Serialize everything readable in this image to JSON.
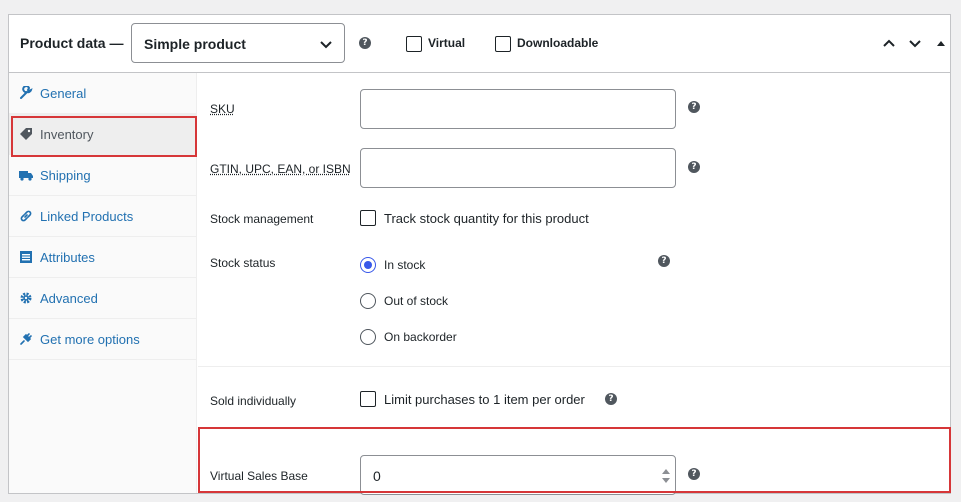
{
  "header": {
    "title": "Product data —",
    "product_type": "Simple product",
    "virtual_label": "Virtual",
    "downloadable_label": "Downloadable",
    "help_glyph": "?"
  },
  "sidebar": {
    "items": [
      {
        "label": "General",
        "icon": "wrench-icon"
      },
      {
        "label": "Inventory",
        "icon": "tag-icon"
      },
      {
        "label": "Shipping",
        "icon": "truck-icon"
      },
      {
        "label": "Linked Products",
        "icon": "link-icon"
      },
      {
        "label": "Attributes",
        "icon": "list-icon"
      },
      {
        "label": "Advanced",
        "icon": "gear-icon"
      },
      {
        "label": "Get more options",
        "icon": "plugin-icon"
      }
    ]
  },
  "inventory": {
    "sku_label": "SKU",
    "sku_value": "",
    "gtin_label": "GTIN, UPC, EAN, or ISBN",
    "gtin_value": "",
    "stock_management_label": "Stock management",
    "stock_management_checkbox": "Track stock quantity for this product",
    "stock_status_label": "Stock status",
    "stock_status_options": [
      "In stock",
      "Out of stock",
      "On backorder"
    ],
    "stock_status_selected": "In stock",
    "sold_individually_label": "Sold individually",
    "sold_individually_checkbox": "Limit purchases to 1 item per order",
    "virtual_sales_base_label": "Virtual Sales Base",
    "virtual_sales_base_value": "0"
  },
  "colors": {
    "link": "#2271b1",
    "highlight": "#d63638",
    "radio_accent": "#3858e9"
  }
}
